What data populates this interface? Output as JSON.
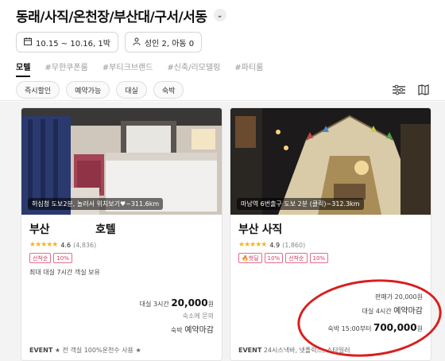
{
  "header": {
    "location_title": "동래/사직/온천장/부산대/구서/서동",
    "date_range": "10.15 ~ 10.16, 1박",
    "guests": "성인 2, 아동 0"
  },
  "tabs": [
    "모텔",
    "#무한쿠폰룸",
    "#부티크브랜드",
    "#신축/리모델링",
    "#파티룸"
  ],
  "filter_chips": [
    "즉시할인",
    "예약가능",
    "대실",
    "숙박"
  ],
  "cards": [
    {
      "location_tag": "허심청 도보2분, 놀러서 위치보기♥~311.6km",
      "name": "부산",
      "name_suffix": "호텔",
      "stars": "★★★★★",
      "score": "4.6",
      "reviews": "(4,836)",
      "badges": [
        "선착순",
        "10%"
      ],
      "note": "최대 대실 7시간 객실 보유",
      "daysplit_label": "대실",
      "daysplit_time": "3시간",
      "daysplit_price": "20,000",
      "won": "원",
      "inquiry": "숙소에 문의",
      "stay_label": "숙박",
      "stay_status": "예약마감",
      "event_label": "EVENT",
      "event_text": "★ 전 객실 100%온천수 사용 ★"
    },
    {
      "location_tag": "마남역 6번출구 도보 2분 (클릭)~312.3km",
      "name": "부산 사직",
      "name_suffix": "",
      "stars": "★★★★★",
      "score": "4.9",
      "reviews": "(1,860)",
      "badges": [
        "🔥핫딜",
        "10%",
        "선착순",
        "10%"
      ],
      "original_label": "판매가",
      "original_price": "20,000원",
      "daysplit_label": "대실",
      "daysplit_time": "4시간",
      "daysplit_status": "예약마감",
      "stay_label": "숙박",
      "stay_time": "15:00부터",
      "stay_price": "700,000",
      "won": "원",
      "event_label": "EVENT",
      "event_text": "24시스낵바, 넷플릭스, 스타일러"
    }
  ],
  "colors": {
    "accent_red": "#d81e1e",
    "star": "#f6b51c",
    "badge": "#d23b62"
  }
}
